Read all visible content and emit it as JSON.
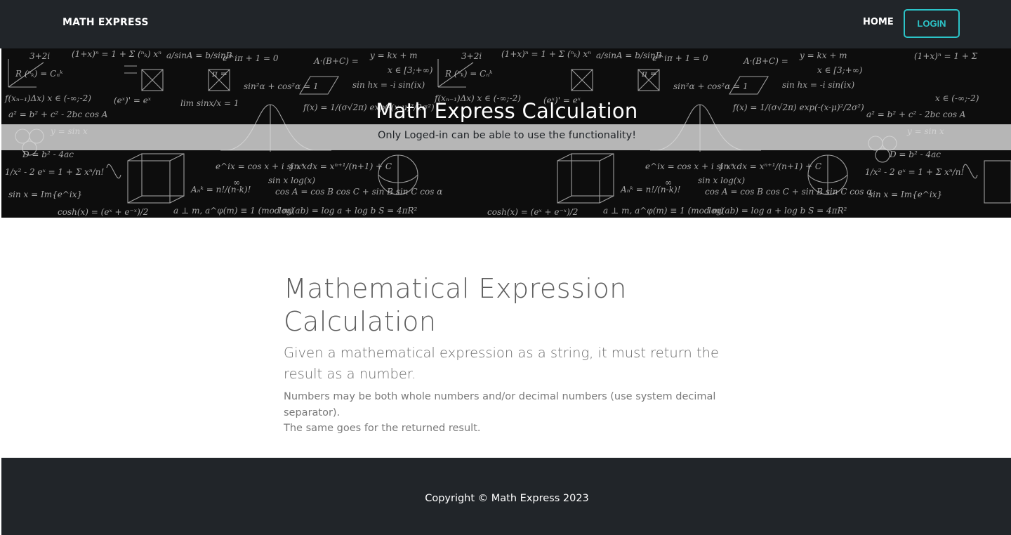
{
  "navbar": {
    "brand": "MATH EXPRESS",
    "home_label": "HOME",
    "login_label": "LOGIN"
  },
  "hero": {
    "title": "Math Express Calculation",
    "subtitle": "Only Loged-in can be able to use the functionality!"
  },
  "main": {
    "heading": "Mathematical Expression Calculation",
    "lead": "Given a mathematical expression as a string, it must return the result as a number.",
    "note_line1": "Numbers may be both whole numbers and/or decimal numbers (use system decimal separator).",
    "note_line2": "The same goes for the returned result."
  },
  "footer": {
    "copyright": "Copyright © Math Express 2023"
  },
  "colors": {
    "dark_bg": "#212529",
    "accent": "#2cc4c8",
    "content_bg": "#ffffff"
  }
}
